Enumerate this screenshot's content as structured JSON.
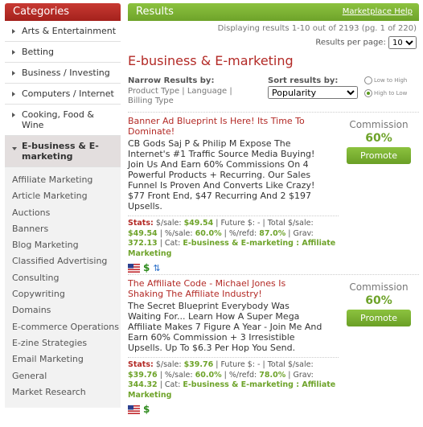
{
  "categories": {
    "header": "Categories",
    "items": [
      {
        "label": "Arts & Entertainment"
      },
      {
        "label": "Betting"
      },
      {
        "label": "Business / Investing"
      },
      {
        "label": "Computers / Internet"
      },
      {
        "label": "Cooking, Food & Wine"
      },
      {
        "label": "E-business & E-marketing",
        "active": true
      }
    ],
    "subcategories": [
      "Affiliate Marketing",
      "Article Marketing",
      "Auctions",
      "Banners",
      "Blog Marketing",
      "Classified Advertising",
      "Consulting",
      "Copywriting",
      "Domains",
      "E-commerce Operations",
      "E-zine Strategies",
      "Email Marketing",
      "General",
      "Market Research"
    ]
  },
  "results": {
    "header": "Results",
    "help_link": "Marketplace Help",
    "displaying": "Displaying results 1-10 out of 2193 (pg. 1 of 220)",
    "per_page_label": "Results per page:",
    "per_page_value": "10",
    "section_title": "E-business & E-marketing",
    "narrow_label": "Narrow Results by:",
    "narrow_links": [
      "Product Type",
      "Language",
      "Billing Type"
    ],
    "sort_label": "Sort results by:",
    "sort_value": "Popularity",
    "sort_low": "Low to High",
    "sort_high": "High to Low",
    "listings": [
      {
        "title": "Banner Ad Blueprint Is Here! Its Time To Dominate!",
        "description": "CB Gods Saj P & Philip M Expose The Internet's #1 Traffic Source Media Buying! Join Us And Earn 60% Commissions On 4 Powerful Products + Recurring. Our Sales Funnel Is Proven And Converts Like Crazy! $77 Front End, $47 Recurring And 2 $197 Upsells.",
        "commission_label": "Commission",
        "commission": "60%",
        "promote": "Promote",
        "stats_label": "Stats:",
        "sale_label": "$/sale:",
        "sale": "$49.54",
        "future_label": "Future $:",
        "future": "-",
        "total_label": "Total $/sale:",
        "total": "$49.54",
        "pct_sale_label": "%/sale:",
        "pct_sale": "60.0%",
        "pct_refd_label": "%/refd:",
        "pct_refd": "87.0%",
        "grav_label": "Grav:",
        "grav": "372.13",
        "cat_label": "Cat:",
        "cat": "E-business & E-marketing : Affiliate Marketing"
      },
      {
        "title": "The Affiliate Code - Michael Jones Is Shaking The Affiliate Industry!",
        "description": "The Secret Blueprint Everybody Was Waiting For... Learn How A Super Mega Affiliate Makes 7 Figure A Year - Join Me And Earn 60% Commission + 3 Irresistible Upsells. Up To $6.3 Per Hop You Send.",
        "commission_label": "Commission",
        "commission": "60%",
        "promote": "Promote",
        "stats_label": "Stats:",
        "sale_label": "$/sale:",
        "sale": "$39.76",
        "future_label": "Future $:",
        "future": "-",
        "total_label": "Total $/sale:",
        "total": "$39.76",
        "pct_sale_label": "%/sale:",
        "pct_sale": "60.0%",
        "pct_refd_label": "%/refd:",
        "pct_refd": "78.0%",
        "grav_label": "Grav:",
        "grav": "344.32",
        "cat_label": "Cat:",
        "cat": "E-business & E-marketing : Affiliate Marketing"
      }
    ]
  },
  "icons": {
    "flag": "us-flag-icon",
    "dollar": "dollar-icon",
    "rebill": "recurring-billing-icon"
  }
}
